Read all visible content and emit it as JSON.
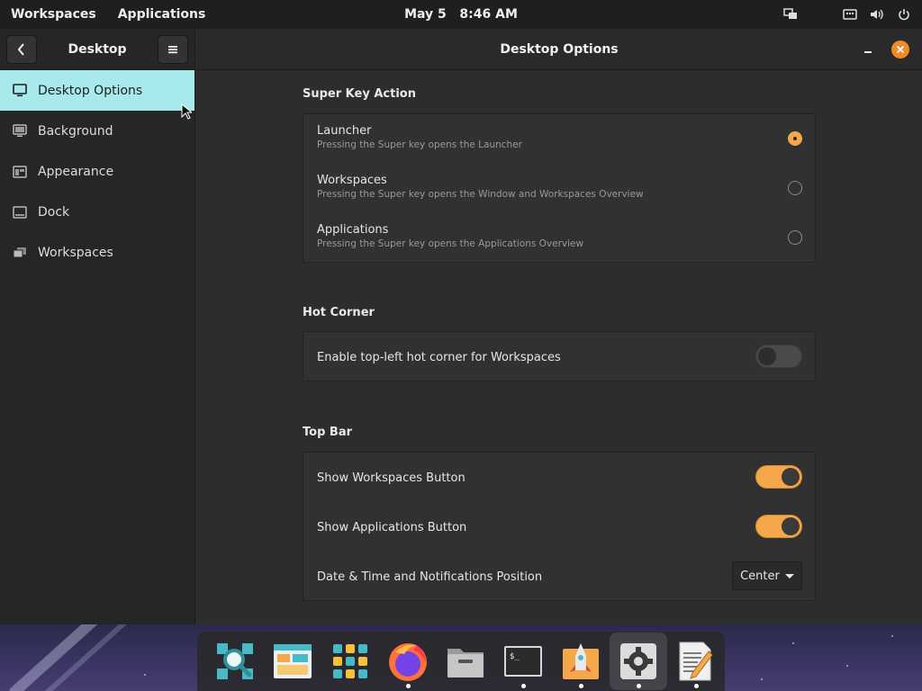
{
  "topbar": {
    "workspaces_label": "Workspaces",
    "applications_label": "Applications",
    "date": "May 5",
    "time": "8:46 AM",
    "icons": [
      "network-icon",
      "keyboard-icon",
      "volume-icon",
      "power-icon"
    ]
  },
  "sidebar": {
    "title": "Desktop",
    "items": [
      {
        "label": "Desktop Options",
        "icon": "monitor-icon",
        "active": true
      },
      {
        "label": "Background",
        "icon": "picture-icon",
        "active": false
      },
      {
        "label": "Appearance",
        "icon": "appearance-icon",
        "active": false
      },
      {
        "label": "Dock",
        "icon": "dock-icon",
        "active": false
      },
      {
        "label": "Workspaces",
        "icon": "workspaces-icon",
        "active": false
      }
    ]
  },
  "main": {
    "title": "Desktop Options",
    "super_key": {
      "heading": "Super Key Action",
      "options": [
        {
          "title": "Launcher",
          "subtitle": "Pressing the Super key opens the Launcher",
          "selected": true
        },
        {
          "title": "Workspaces",
          "subtitle": "Pressing the Super key opens the Window and Workspaces Overview",
          "selected": false
        },
        {
          "title": "Applications",
          "subtitle": "Pressing the Super key opens the Applications Overview",
          "selected": false
        }
      ]
    },
    "hot_corner": {
      "heading": "Hot Corner",
      "label": "Enable top-left hot corner for Workspaces",
      "enabled": false
    },
    "top_bar": {
      "heading": "Top Bar",
      "show_workspaces_label": "Show Workspaces Button",
      "show_workspaces": true,
      "show_applications_label": "Show Applications Button",
      "show_applications": true,
      "datetime_label": "Date & Time and Notifications Position",
      "datetime_value": "Center"
    }
  },
  "dock": {
    "apps": [
      "search-app-icon",
      "file-manager-window-icon",
      "app-grid-icon",
      "firefox-icon",
      "files-icon",
      "terminal-icon",
      "launcher-app-icon",
      "settings-icon",
      "text-editor-icon"
    ]
  },
  "colors": {
    "accent": "#f5a849",
    "active_item": "#a8e9ec",
    "close": "#f0892a"
  }
}
